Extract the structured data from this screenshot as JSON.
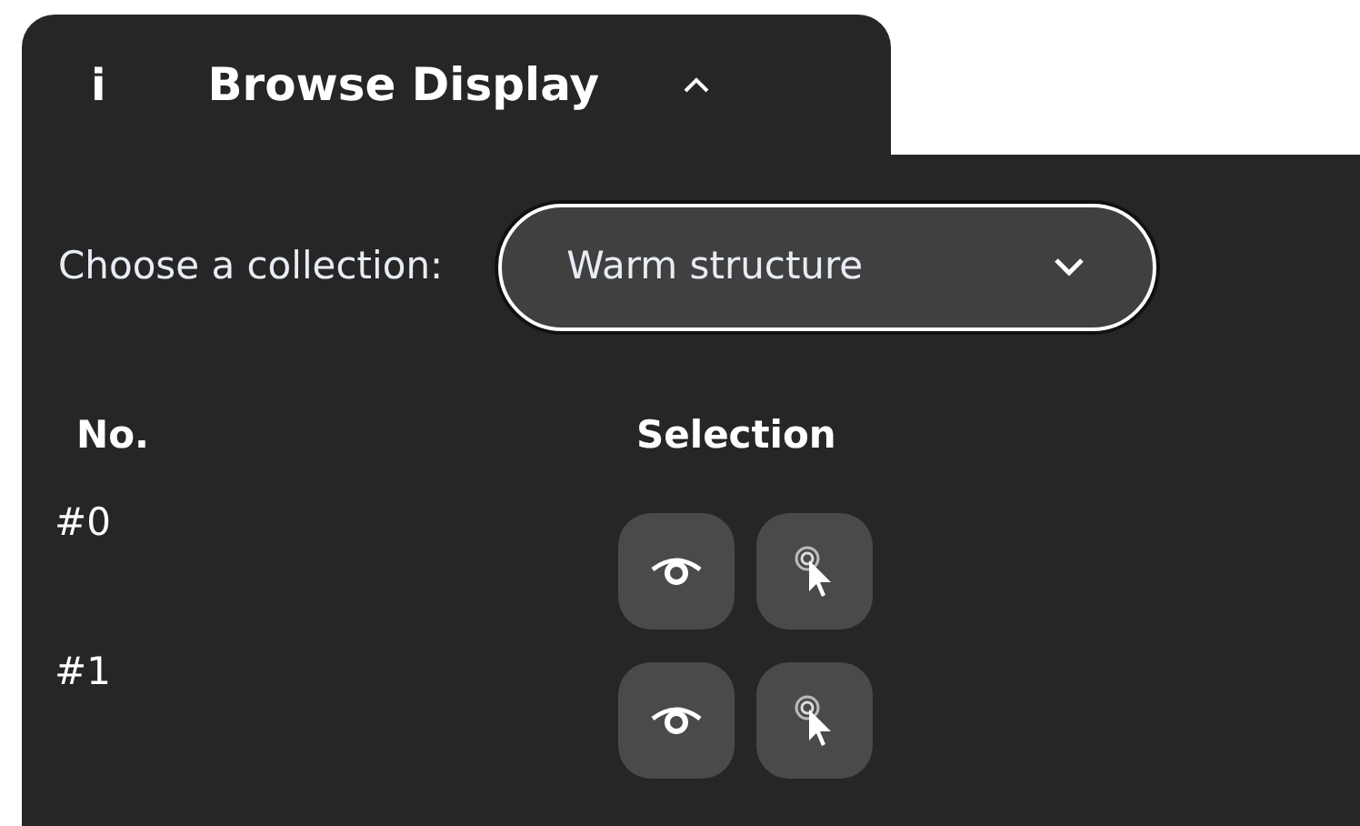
{
  "panel": {
    "info_icon": "i",
    "title": "Browse Display",
    "expanded": true
  },
  "collection": {
    "label": "Choose a collection:",
    "value": "Warm structure"
  },
  "table": {
    "columns": [
      "No.",
      "Selection"
    ],
    "rows": [
      {
        "number": "#0"
      },
      {
        "number": "#1"
      }
    ]
  }
}
